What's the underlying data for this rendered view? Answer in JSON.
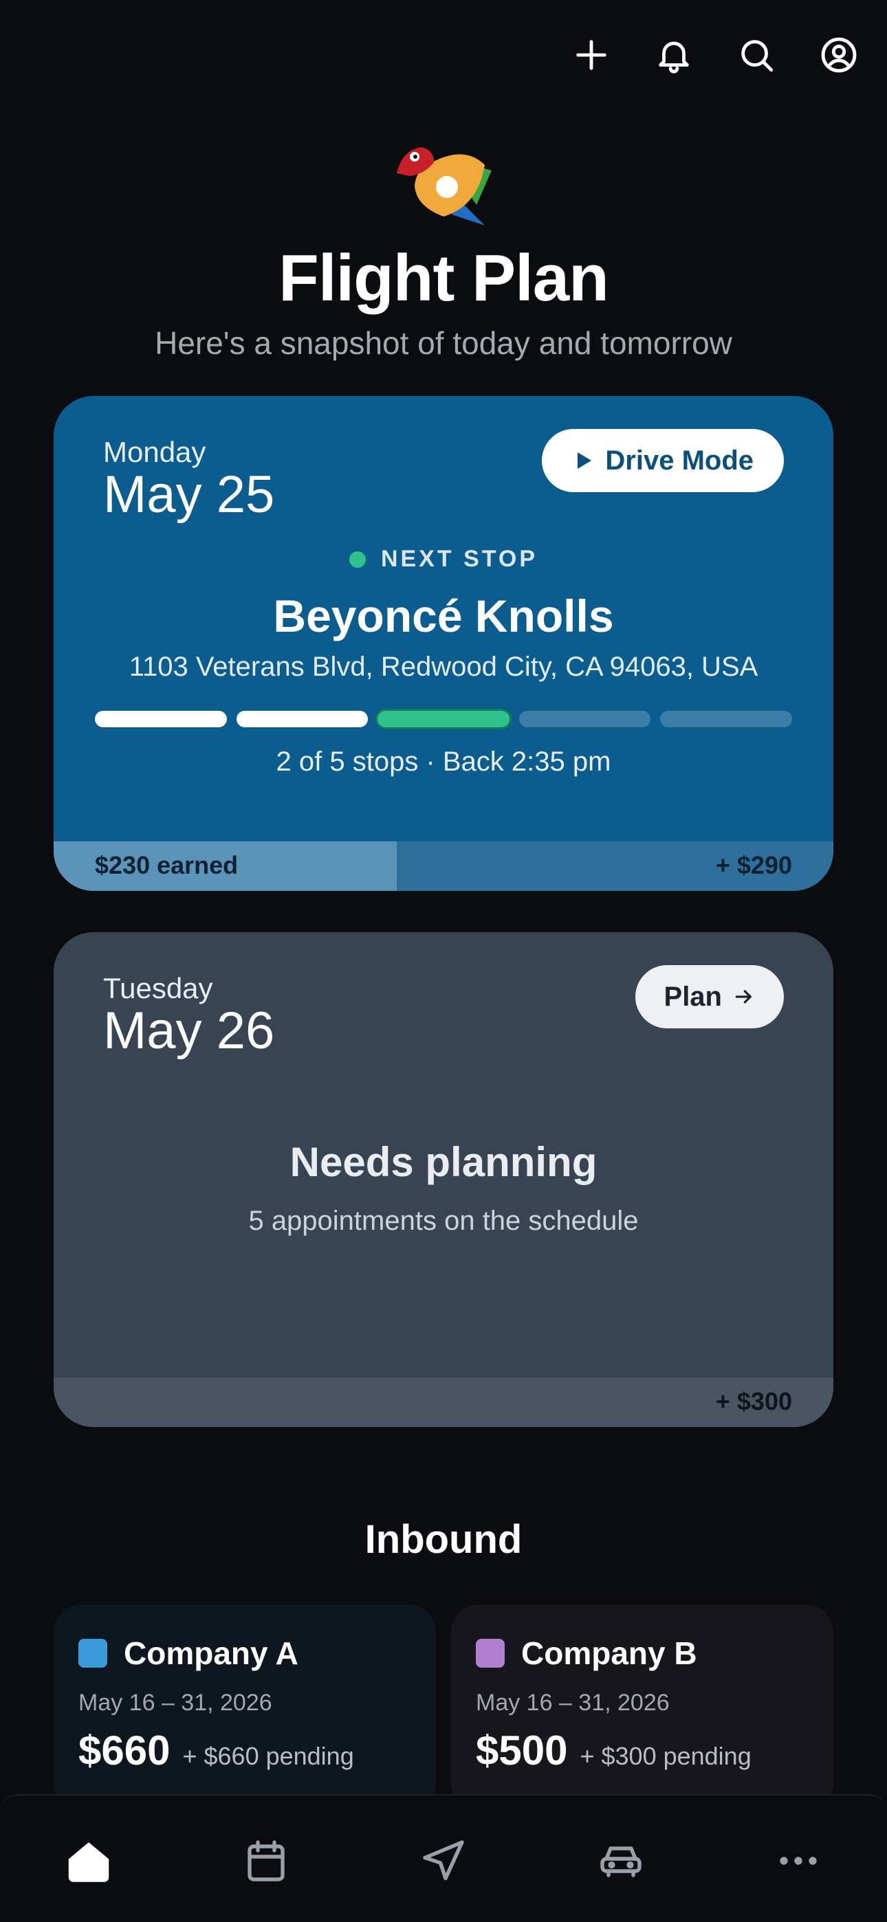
{
  "header": {
    "icons": [
      "plus-icon",
      "bell-icon",
      "search-icon",
      "account-icon"
    ]
  },
  "hero": {
    "title": "Flight Plan",
    "subtitle": "Here's a snapshot of today and tomorrow"
  },
  "today": {
    "day_name": "Monday",
    "date": "May 25",
    "action_label": "Drive Mode",
    "next_stop_label": "NEXT STOP",
    "stop_name": "Beyoncé Knolls",
    "stop_address": "1103 Veterans Blvd, Redwood City, CA 94063, USA",
    "progress": {
      "total_segments": 5,
      "completed": 2,
      "current": 3
    },
    "stops_info": "2 of 5 stops · Back 2:35 pm",
    "earned_label": "$230 earned",
    "remaining_label": "+ $290",
    "earned_fraction": 0.44
  },
  "tomorrow": {
    "day_name": "Tuesday",
    "date": "May 26",
    "action_label": "Plan",
    "status_title": "Needs planning",
    "status_subtitle": "5 appointments on the schedule",
    "remaining_label": "+ $300"
  },
  "inbound": {
    "title": "Inbound",
    "companies": [
      {
        "name": "Company A",
        "range": "May 16 – 31, 2026",
        "amount": "$660",
        "pending": "+ $660 pending",
        "color": "#3b9bdb"
      },
      {
        "name": "Company B",
        "range": "May 16 – 31, 2026",
        "amount": "$500",
        "pending": "+ $300 pending",
        "color": "#b07fcf"
      }
    ]
  },
  "nav": {
    "items": [
      "home-icon",
      "calendar-icon",
      "navigation-icon",
      "car-icon",
      "more-icon"
    ],
    "active": "home-icon"
  },
  "colors": {
    "background": "#0b0c10",
    "today_card": "#0b5d90",
    "tomorrow_card": "#394453",
    "accent_green": "#2ec28e"
  }
}
